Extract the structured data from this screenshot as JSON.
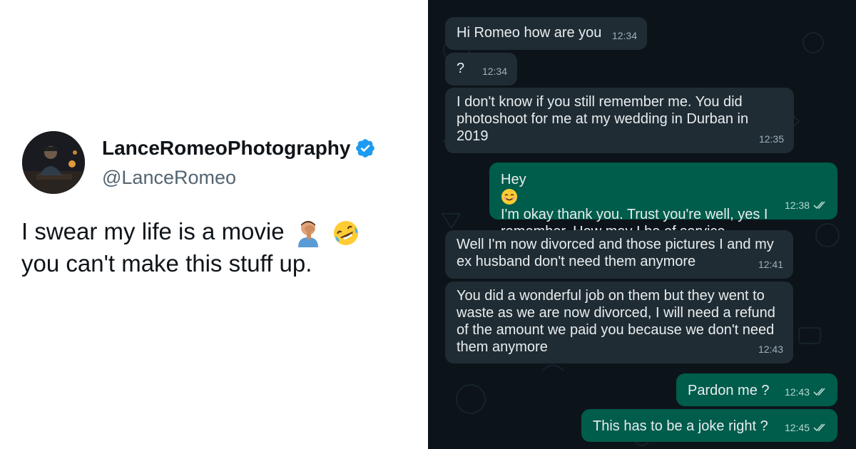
{
  "tweet": {
    "display_name": "LanceRomeoPhotography",
    "handle": "@LanceRomeo",
    "verified_icon": "verified-badge-icon",
    "text_line1": "I swear my life is a movie",
    "text_line2": "you can't make this stuff up.",
    "emojis": [
      "man-facepalming-emoji",
      "rolling-on-floor-laughing-emoji"
    ]
  },
  "chat": {
    "messages": [
      {
        "id": "m1",
        "direction": "incoming",
        "text": "Hi Romeo how are you",
        "time": "12:34"
      },
      {
        "id": "m2",
        "direction": "incoming",
        "text": "?",
        "time": "12:34"
      },
      {
        "id": "m3",
        "direction": "incoming",
        "text": "I don't know if you still remember me. You did\nphotoshoot for me at my wedding in Durban in\n2019",
        "time": "12:35"
      },
      {
        "id": "m4",
        "direction": "outgoing",
        "text_before_emoji": "Hey",
        "emoji": "smiling-face-emoji",
        "text_after_emoji": "I'm okay thank you. Trust you're well, yes I\nremember. How may I be of service",
        "time": "12:38",
        "status": "read"
      },
      {
        "id": "m5",
        "direction": "incoming",
        "text": "Well I'm now divorced and those pictures I and my\nex husband don't need them anymore",
        "time": "12:41"
      },
      {
        "id": "m6",
        "direction": "incoming",
        "text": "You did a wonderful job on them but they went to\nwaste as we are now divorced, I will need a refund\nof the amount we paid you because we don't need\nthem anymore",
        "time": "12:43"
      },
      {
        "id": "m7",
        "direction": "outgoing",
        "text": "Pardon me ?",
        "time": "12:43",
        "status": "read"
      },
      {
        "id": "m8",
        "direction": "outgoing",
        "text": "This has to be a joke right ?",
        "time": "12:45",
        "status": "read"
      }
    ],
    "colors": {
      "background": "#0c1419",
      "incoming_bubble": "#1f2c33",
      "outgoing_bubble": "#005c4b",
      "tweet_text": "#0f1419",
      "handle_gray": "#536471",
      "verified_blue": "#1d9bf0"
    }
  }
}
